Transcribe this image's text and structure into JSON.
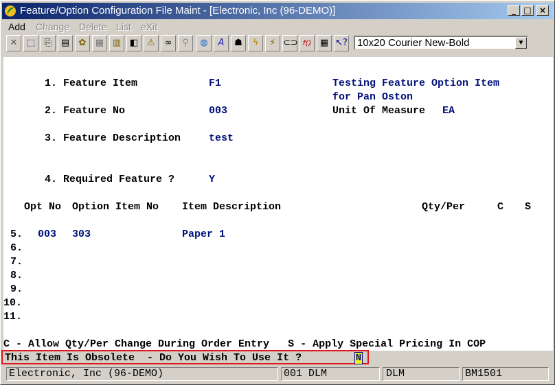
{
  "window": {
    "title": "Feature/Option Configuration File Maint - [Electronic, Inc (96-DEMO)]"
  },
  "menu": [
    {
      "label": "Add",
      "enabled": true
    },
    {
      "label": "Change",
      "enabled": false
    },
    {
      "label": "Delete",
      "enabled": false
    },
    {
      "label": "List",
      "enabled": false
    },
    {
      "label": "eXit",
      "enabled": false
    }
  ],
  "toolbar": {
    "icons": [
      "close-x-icon",
      "select-box-icon",
      "copy-icon",
      "paste-icon",
      "settings-icon",
      "properties-icon",
      "notepad-icon",
      "print-preview-icon",
      "warning-icon",
      "binoculars-icon",
      "search-icon",
      "globe-icon",
      "text-a-icon",
      "lookup-icon",
      "lightning-icon",
      "run-icon",
      "link-icon",
      "function-icon",
      "calculator-icon",
      "help-pointer-icon"
    ],
    "font_selector": "10x20 Courier New-Bold"
  },
  "form": {
    "f1_label": "1. Feature Item",
    "f1_value": "F1",
    "f1_desc1": "Testing Feature Option Item",
    "f1_desc2": "for Pan Oston",
    "f2_label": "2. Feature No",
    "f2_value": "003",
    "uom_label": "Unit Of Measure",
    "uom_value": "EA",
    "f3_label": "3. Feature Description",
    "f3_value": "test",
    "f4_label": "4. Required Feature ?",
    "f4_value": "Y"
  },
  "grid": {
    "headers": {
      "opt_no": "Opt No",
      "option_item_no": "Option Item No",
      "item_description": "Item Description",
      "qty_per": "Qty/Per",
      "c": "C",
      "s": "S"
    },
    "rows": [
      {
        "line": "5.",
        "opt_no": "003",
        "item_no": "303",
        "desc": "Paper 1"
      },
      {
        "line": "6.",
        "opt_no": "",
        "item_no": "",
        "desc": ""
      },
      {
        "line": "7.",
        "opt_no": "",
        "item_no": "",
        "desc": ""
      },
      {
        "line": "8.",
        "opt_no": "",
        "item_no": "",
        "desc": ""
      },
      {
        "line": "9.",
        "opt_no": "",
        "item_no": "",
        "desc": ""
      },
      {
        "line": "10.",
        "opt_no": "",
        "item_no": "",
        "desc": ""
      },
      {
        "line": "11.",
        "opt_no": "",
        "item_no": "",
        "desc": ""
      }
    ]
  },
  "legend": "C - Allow Qty/Per Change During Order Entry   S - Apply Special Pricing In COP",
  "prompt": {
    "message": "This Item Is Obsolete  - Do You Wish To Use It ?",
    "answer": "N"
  },
  "status": {
    "company": "Electronic, Inc (96-DEMO)",
    "user_code": "001 DLM",
    "user": "DLM",
    "program": "BM1501"
  }
}
